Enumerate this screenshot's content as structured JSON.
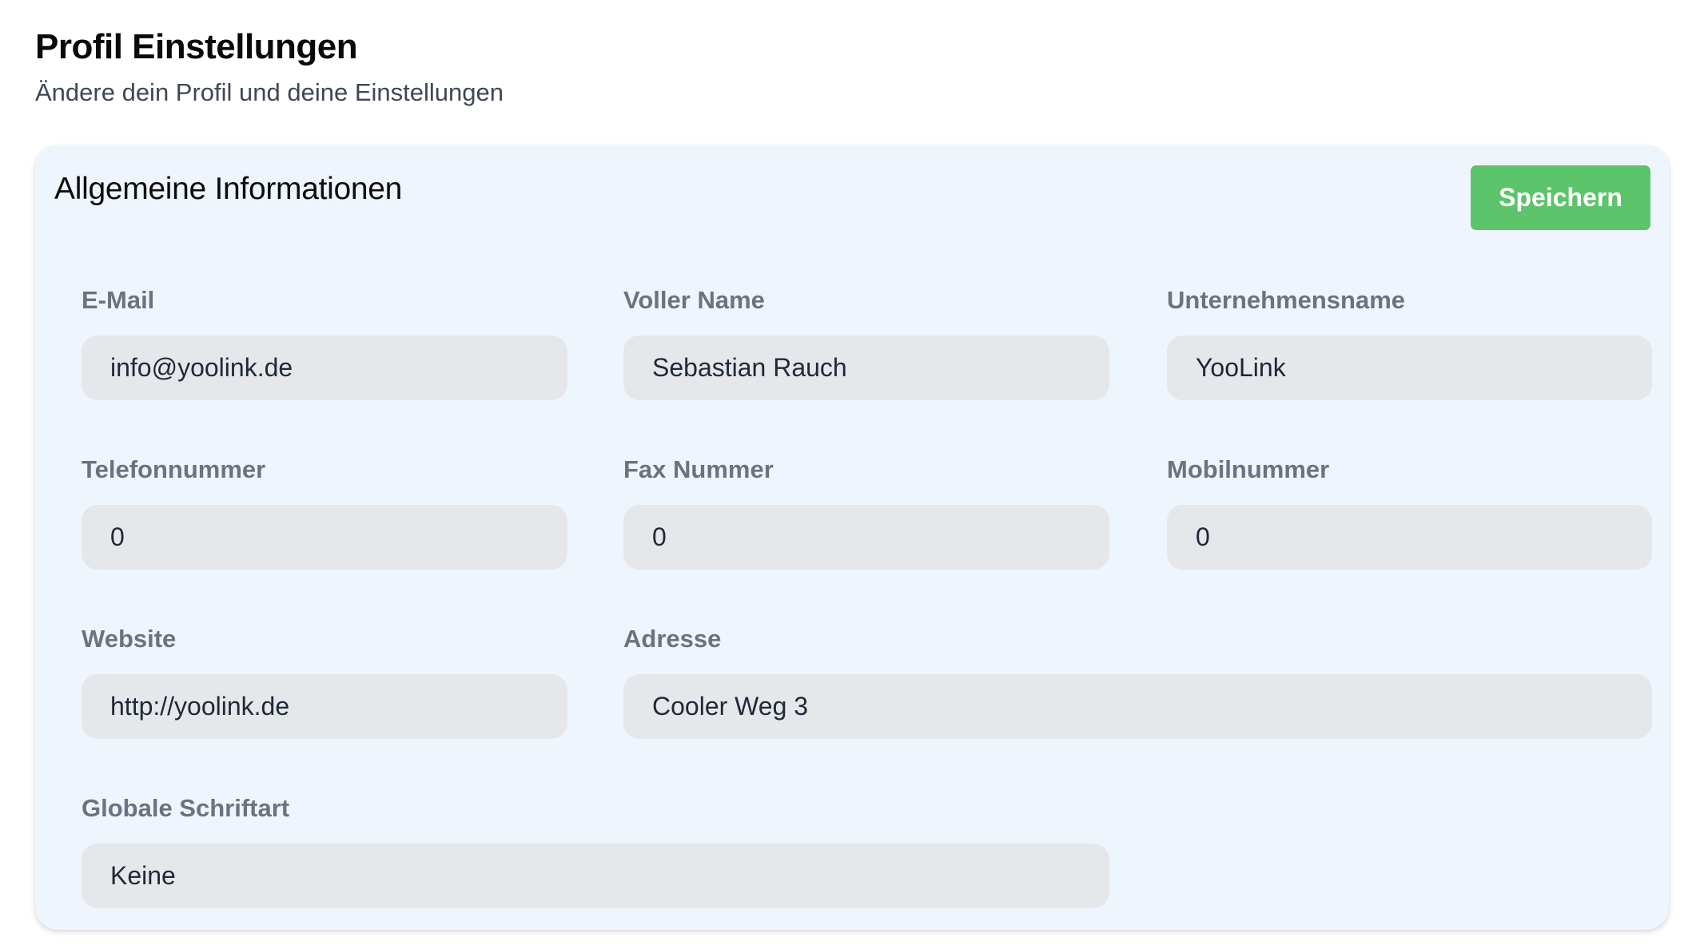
{
  "header": {
    "title": "Profil Einstellungen",
    "subtitle": "Ändere dein Profil und deine Einstellungen"
  },
  "card": {
    "title": "Allgemeine Informationen",
    "save_label": "Speichern"
  },
  "fields": {
    "email": {
      "label": "E-Mail",
      "value": "info@yoolink.de"
    },
    "full_name": {
      "label": "Voller Name",
      "value": "Sebastian Rauch"
    },
    "company": {
      "label": "Unternehmensname",
      "value": "YooLink"
    },
    "phone": {
      "label": "Telefonnummer",
      "value": "0"
    },
    "fax": {
      "label": "Fax Nummer",
      "value": "0"
    },
    "mobile": {
      "label": "Mobilnummer",
      "value": "0"
    },
    "website": {
      "label": "Website",
      "value": "http://yoolink.de"
    },
    "address": {
      "label": "Adresse",
      "value": "Cooler Weg 3"
    },
    "font": {
      "label": "Globale Schriftart",
      "value": "Keine"
    }
  },
  "colors": {
    "accent": "#5cc46a",
    "card_background": "#eff5fd",
    "input_background": "#e5e7eb",
    "label": "#6b7280"
  }
}
